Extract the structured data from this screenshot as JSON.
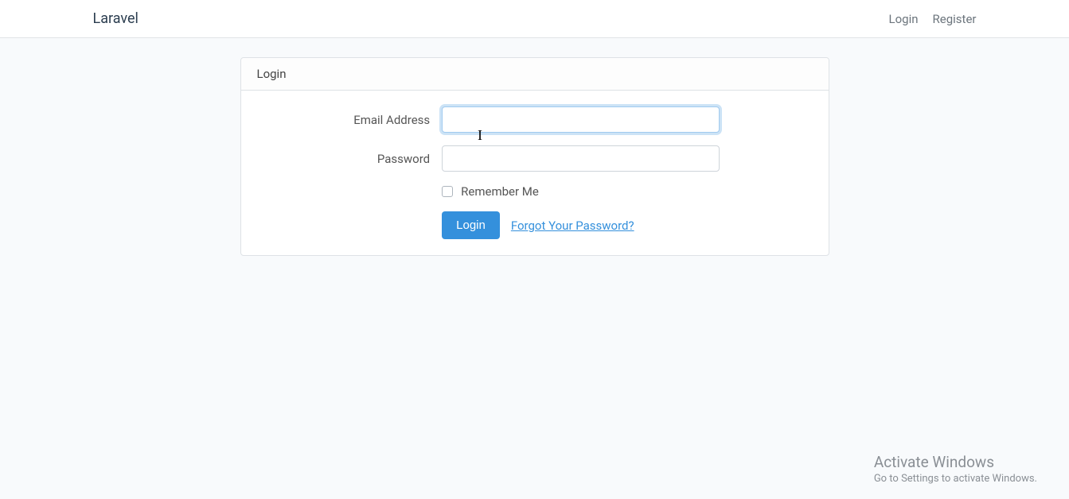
{
  "navbar": {
    "brand": "Laravel",
    "login_link": "Login",
    "register_link": "Register"
  },
  "card": {
    "header": "Login"
  },
  "form": {
    "email_label": "Email Address",
    "email_value": "",
    "password_label": "Password",
    "password_value": "",
    "remember_label": "Remember Me",
    "login_button": "Login",
    "forgot_link": "Forgot Your Password?"
  },
  "watermark": {
    "title": "Activate Windows",
    "sub": "Go to Settings to activate Windows."
  }
}
